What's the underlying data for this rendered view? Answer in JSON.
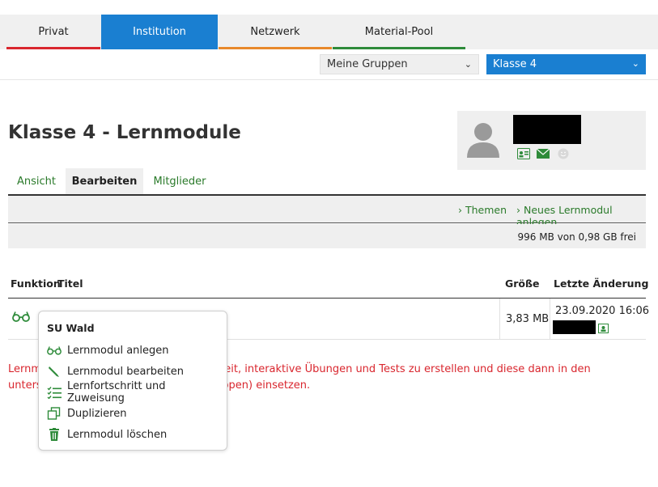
{
  "top_tabs": [
    {
      "label": "Privat",
      "color": "#d9262e"
    },
    {
      "label": "Institution",
      "color": "#1a7fd1"
    },
    {
      "label": "Netzwerk",
      "color": "#e8892b"
    },
    {
      "label": "Material-Pool",
      "color": "#2e8b3a"
    }
  ],
  "selects": {
    "groups": "Meine Gruppen",
    "class": "Klasse 4"
  },
  "page_title": "Klasse 4 - Lernmodule",
  "sub_tabs": [
    "Ansicht",
    "Bearbeiten",
    "Mitglieder"
  ],
  "actions": {
    "themen": "Themen",
    "new_module": "Neues Lernmodul anlegen"
  },
  "quota": "996 MB von 0,98 GB frei",
  "table": {
    "headers": [
      "Funktion",
      "Titel",
      "Größe",
      "Letzte Änderung"
    ],
    "row": {
      "size": "3,83 MB",
      "date": "23.09.2020 16:06"
    }
  },
  "info_text": {
    "line1": "Lernm                                      e Möglichkeit, interaktive Übungen und Tests zu erstellen und diese dann in den",
    "line2": "unters                                     n oder Gruppen) einsetzen."
  },
  "context_menu": {
    "title": "SU Wald",
    "items": [
      {
        "label": "Lernmodul anlegen",
        "icon": "glasses-icon"
      },
      {
        "label": "Lernmodul bearbeiten",
        "icon": "pencil-icon"
      },
      {
        "label": "Lernfortschritt und Zuweisung",
        "icon": "checklist-icon"
      },
      {
        "label": "Duplizieren",
        "icon": "duplicate-icon"
      },
      {
        "label": "Lernmodul löschen",
        "icon": "trash-icon"
      }
    ]
  },
  "colors": {
    "green": "#2e8b3a",
    "blue": "#1a7fd1",
    "red": "#d9262e"
  }
}
